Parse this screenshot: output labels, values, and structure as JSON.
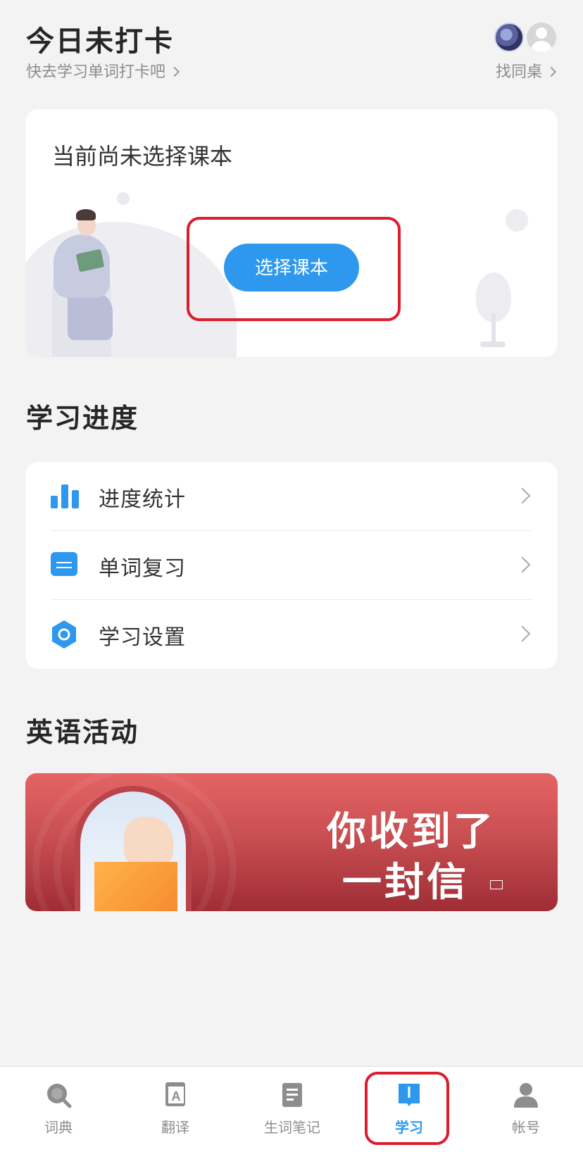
{
  "header": {
    "title": "今日未打卡",
    "subtitle": "快去学习单词打卡吧",
    "deskmate_label": "找同桌"
  },
  "textbook_card": {
    "title": "当前尚未选择课本",
    "select_button": "选择课本"
  },
  "progress": {
    "section_title": "学习进度",
    "items": [
      {
        "label": "进度统计",
        "icon": "bar-chart-icon"
      },
      {
        "label": "单词复习",
        "icon": "card-stack-icon"
      },
      {
        "label": "学习设置",
        "icon": "hexagon-settings-icon"
      }
    ]
  },
  "activities": {
    "section_title": "英语活动",
    "banner_line1": "你收到了",
    "banner_line2": "一封信"
  },
  "tabbar": {
    "tabs": [
      {
        "label": "词典",
        "icon": "search-icon"
      },
      {
        "label": "翻译",
        "icon": "translate-icon"
      },
      {
        "label": "生词笔记",
        "icon": "notes-icon"
      },
      {
        "label": "学习",
        "icon": "book-icon",
        "active": true
      },
      {
        "label": "帐号",
        "icon": "person-icon"
      }
    ]
  },
  "colors": {
    "accent": "#2e98ee",
    "highlight_box": "#dc1d2e",
    "background": "#f3f3f4"
  }
}
